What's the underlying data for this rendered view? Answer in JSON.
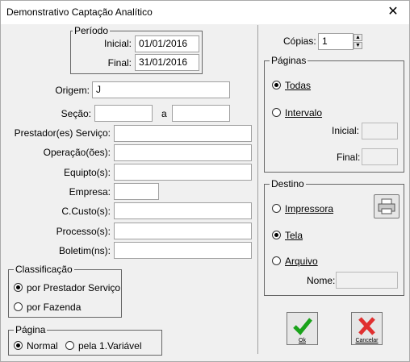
{
  "window": {
    "title": "Demonstrativo Captação Analítico",
    "close_glyph": "✕"
  },
  "periodo": {
    "legend": "Período",
    "inicial_label": "Inicial:",
    "inicial_value": "01/01/2016",
    "final_label": "Final:",
    "final_value": "31/01/2016"
  },
  "fields": {
    "origem_label": "Origem:",
    "origem_value": "J",
    "secao_label": "Seção:",
    "secao_sep": "a",
    "prestador_label": "Prestador(es) Serviço:",
    "operacao_label": "Operação(ões):",
    "equipto_label": "Equipto(s):",
    "empresa_label": "Empresa:",
    "ccusto_label": "C.Custo(s):",
    "processo_label": "Processo(s):",
    "boletim_label": "Boletim(ns):"
  },
  "classificacao": {
    "legend": "Classificação",
    "opt1": "por Prestador Serviço",
    "opt2": "por Fazenda",
    "selected": "opt1"
  },
  "pagina": {
    "legend": "Página",
    "opt1": "Normal",
    "opt2": "pela 1.Variável",
    "selected": "opt1"
  },
  "copias": {
    "label": "Cópias:",
    "value": "1"
  },
  "paginas": {
    "legend": "Páginas",
    "todas": "Todas",
    "intervalo": "Intervalo",
    "inicial_label": "Inicial:",
    "final_label": "Final:",
    "selected": "todas"
  },
  "destino": {
    "legend": "Destino",
    "impressora": "Impressora",
    "tela": "Tela",
    "arquivo": "Arquivo",
    "nome_label": "Nome:",
    "selected": "tela"
  },
  "buttons": {
    "ok_label": "Ok",
    "cancelar_label": "Cancelar"
  },
  "colors": {
    "ok_check": "#1aa31a",
    "cancel_x": "#e03030",
    "window_bg": "#f0f0f0"
  },
  "icons": {
    "printer": "printer-icon",
    "ok": "checkmark-icon",
    "cancel": "x-icon"
  }
}
